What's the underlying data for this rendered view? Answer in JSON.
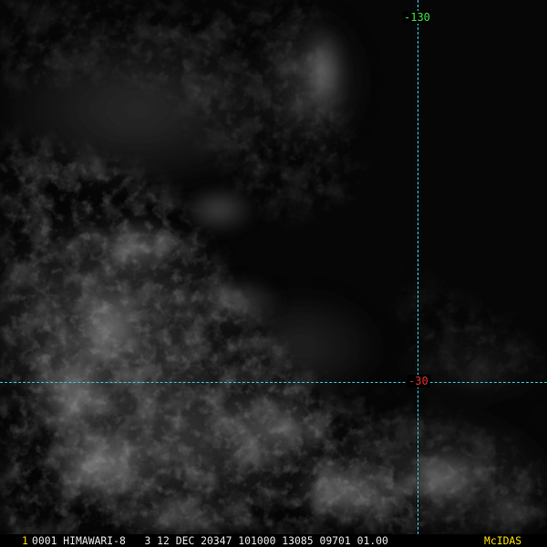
{
  "image": {
    "grid": {
      "longitude_label": "-130",
      "latitude_label": "-30",
      "line_color": "#3fc8d8",
      "longitude_label_color": "#3fe03f",
      "latitude_label_color": "#e03030"
    },
    "status_bar": {
      "frame_number": "1",
      "text": "0001 HIMAWARI-8   3 12 DEC 20347 101000 13085 09701 01.00",
      "software_label": "McIDAS",
      "frame_number_color": "#ffd700",
      "software_label_color": "#ffe000"
    }
  }
}
